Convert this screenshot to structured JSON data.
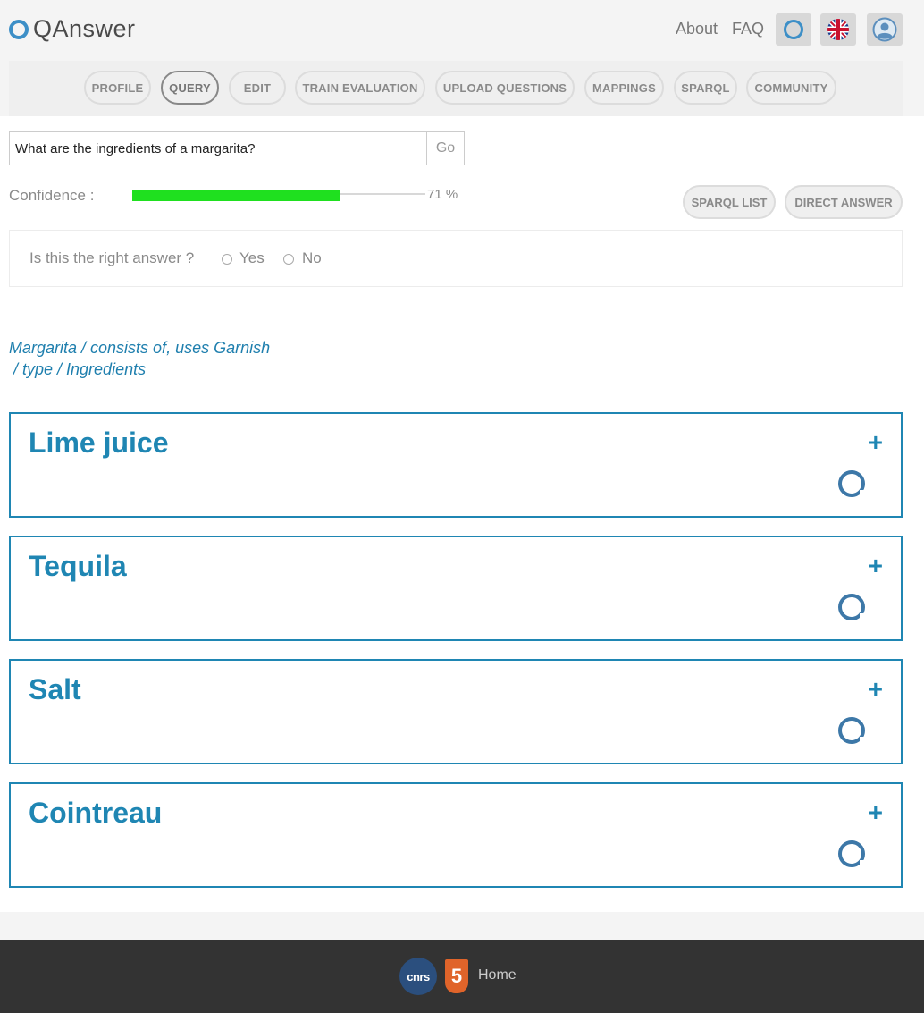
{
  "header": {
    "logo_text": "QAnswer",
    "about": "About",
    "faq": "FAQ",
    "buttons": [
      "qanswer-ring-icon",
      "uk-flag-icon",
      "user-avatar-icon"
    ]
  },
  "tabs": [
    {
      "label": "PROFILE",
      "active": false
    },
    {
      "label": "QUERY",
      "active": true
    },
    {
      "label": "EDIT",
      "active": false
    },
    {
      "label": "TRAIN EVALUATION",
      "active": false
    },
    {
      "label": "UPLOAD QUESTIONS",
      "active": false
    },
    {
      "label": "MAPPINGS",
      "active": false
    },
    {
      "label": "SPARQL",
      "active": false
    },
    {
      "label": "COMMUNITY",
      "active": false
    }
  ],
  "search": {
    "value": "What are the ingredients of a margarita?",
    "go_label": "Go"
  },
  "confidence": {
    "label": "Confidence :",
    "value_text": "71 %",
    "fraction": 0.71,
    "fill_color": "#1fe01f"
  },
  "actions": {
    "sparql_list": "SPARQL LIST",
    "direct_answer": "DIRECT ANSWER"
  },
  "feedback": {
    "question": "Is this the right answer ?",
    "yes": "Yes",
    "no": "No"
  },
  "interpretation": {
    "line1": "Margarita / consists of, uses Garnish",
    "line2": " / type / Ingredients"
  },
  "answers": [
    {
      "title": "Lime juice",
      "expand": "+"
    },
    {
      "title": "Tequila",
      "expand": "+"
    },
    {
      "title": "Salt",
      "expand": "+"
    },
    {
      "title": "Cointreau",
      "expand": "+"
    }
  ],
  "footer": {
    "cnrs_logo": "cnrs",
    "ujm_logo": "5",
    "home": "Home"
  },
  "colors": {
    "accent": "#1f86b3",
    "logo_ring": "#3d8fc7"
  }
}
